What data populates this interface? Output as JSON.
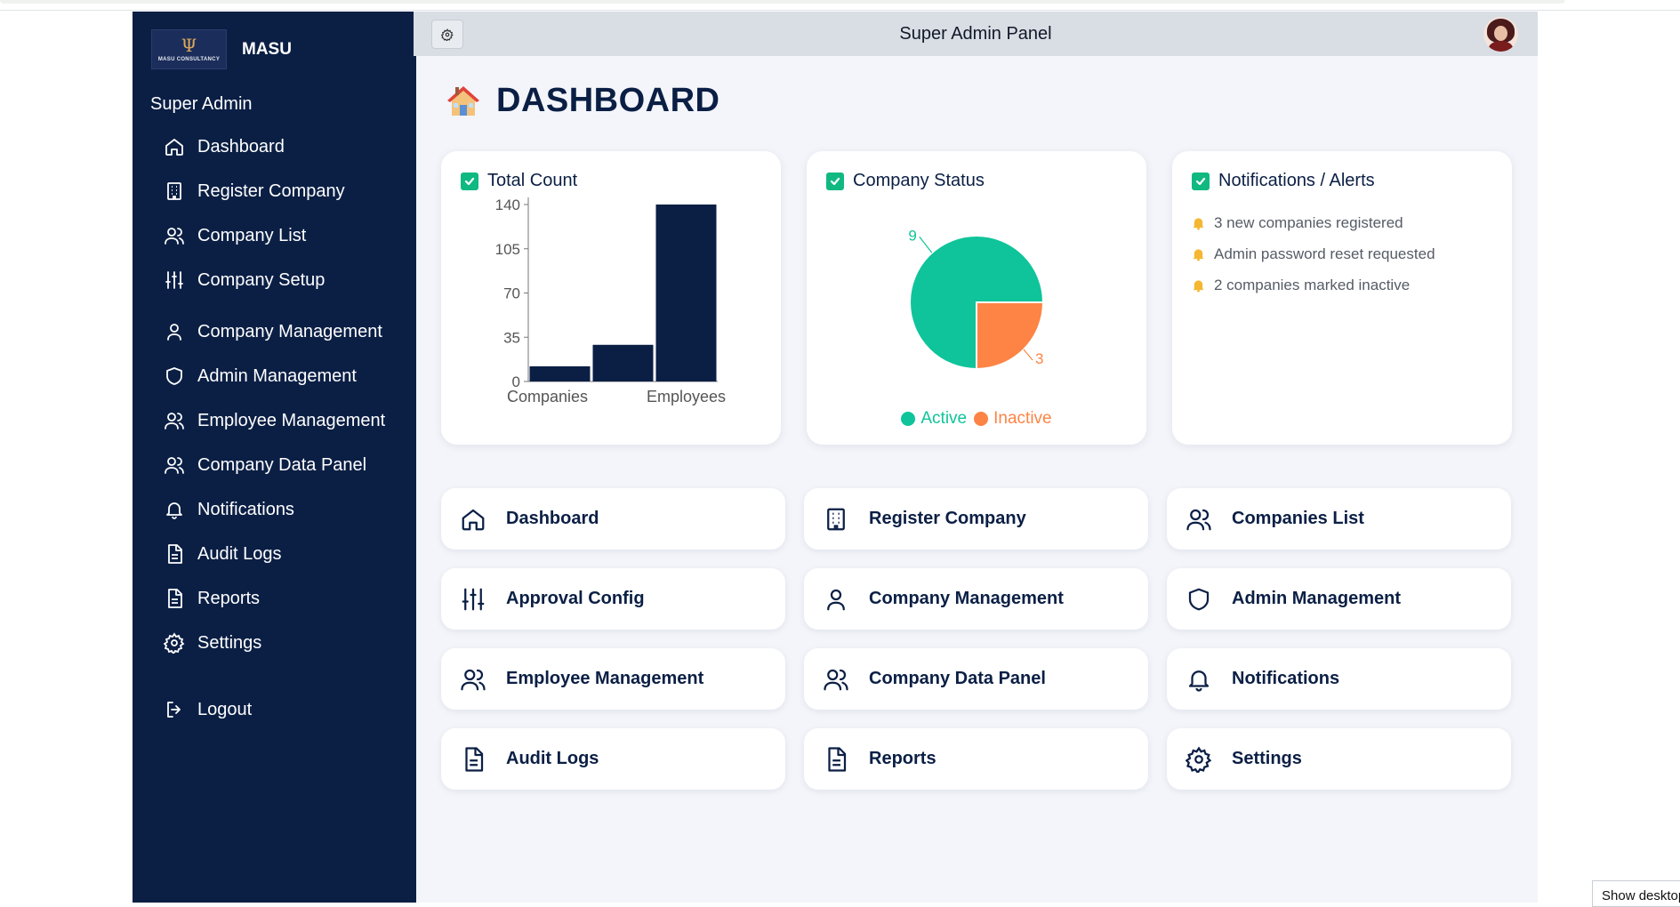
{
  "brand": {
    "name": "MASU",
    "logo_text": "MASU CONSULTANCY"
  },
  "sidebar": {
    "role": "Super Admin",
    "items": [
      {
        "label": "Dashboard",
        "icon": "home-icon"
      },
      {
        "label": "Register Company",
        "icon": "building-icon"
      },
      {
        "label": "Company List",
        "icon": "users-icon"
      },
      {
        "label": "Company Setup",
        "icon": "sliders-icon"
      },
      {
        "label": "Company Management",
        "icon": "user-icon"
      },
      {
        "label": "Admin Management",
        "icon": "shield-icon"
      },
      {
        "label": "Employee Management",
        "icon": "users-icon"
      },
      {
        "label": "Company Data Panel",
        "icon": "users-icon"
      },
      {
        "label": "Notifications",
        "icon": "bell-icon"
      },
      {
        "label": "Audit Logs",
        "icon": "file-text-icon"
      },
      {
        "label": "Reports",
        "icon": "file-text-icon"
      },
      {
        "label": "Settings",
        "icon": "gear-icon"
      }
    ],
    "logout": "Logout"
  },
  "header": {
    "title": "Super Admin Panel"
  },
  "page": {
    "title": "DASHBOARD"
  },
  "cards": {
    "total_count": {
      "title": "Total Count"
    },
    "company_status": {
      "title": "Company Status",
      "legend": [
        "Active",
        "Inactive"
      ]
    },
    "notifications": {
      "title": "Notifications / Alerts",
      "items": [
        "3 new companies registered",
        "Admin password reset requested",
        "2 companies marked inactive"
      ]
    }
  },
  "chart_data": [
    {
      "type": "bar",
      "categories": [
        "Companies",
        "",
        "Employees"
      ],
      "values": [
        12,
        29,
        140
      ],
      "ylim": [
        0,
        140
      ],
      "yticks": [
        "0",
        "35",
        "70",
        "105",
        "140"
      ],
      "xticklabels": [
        "Companies",
        "Employees"
      ],
      "color": "#0b1f45"
    },
    {
      "type": "pie",
      "labels": [
        "Active",
        "Inactive"
      ],
      "values": [
        9,
        3
      ],
      "data_labels": [
        "9",
        "3"
      ],
      "colors": [
        "#0fc49a",
        "#fd8445"
      ],
      "legend": "bottom"
    }
  ],
  "tiles": [
    {
      "label": "Dashboard",
      "icon": "home-icon"
    },
    {
      "label": "Register Company",
      "icon": "building-icon"
    },
    {
      "label": "Companies List",
      "icon": "users-icon"
    },
    {
      "label": "Approval Config",
      "icon": "sliders-icon"
    },
    {
      "label": "Company Management",
      "icon": "user-icon"
    },
    {
      "label": "Admin Management",
      "icon": "shield-icon"
    },
    {
      "label": "Employee Management",
      "icon": "users-icon"
    },
    {
      "label": "Company Data Panel",
      "icon": "users-icon"
    },
    {
      "label": "Notifications",
      "icon": "bell-icon"
    },
    {
      "label": "Audit Logs",
      "icon": "file-text-icon"
    },
    {
      "label": "Reports",
      "icon": "file-text-icon"
    },
    {
      "label": "Settings",
      "icon": "gear-icon"
    }
  ],
  "browser": {
    "show_desktop": "Show desktop"
  }
}
